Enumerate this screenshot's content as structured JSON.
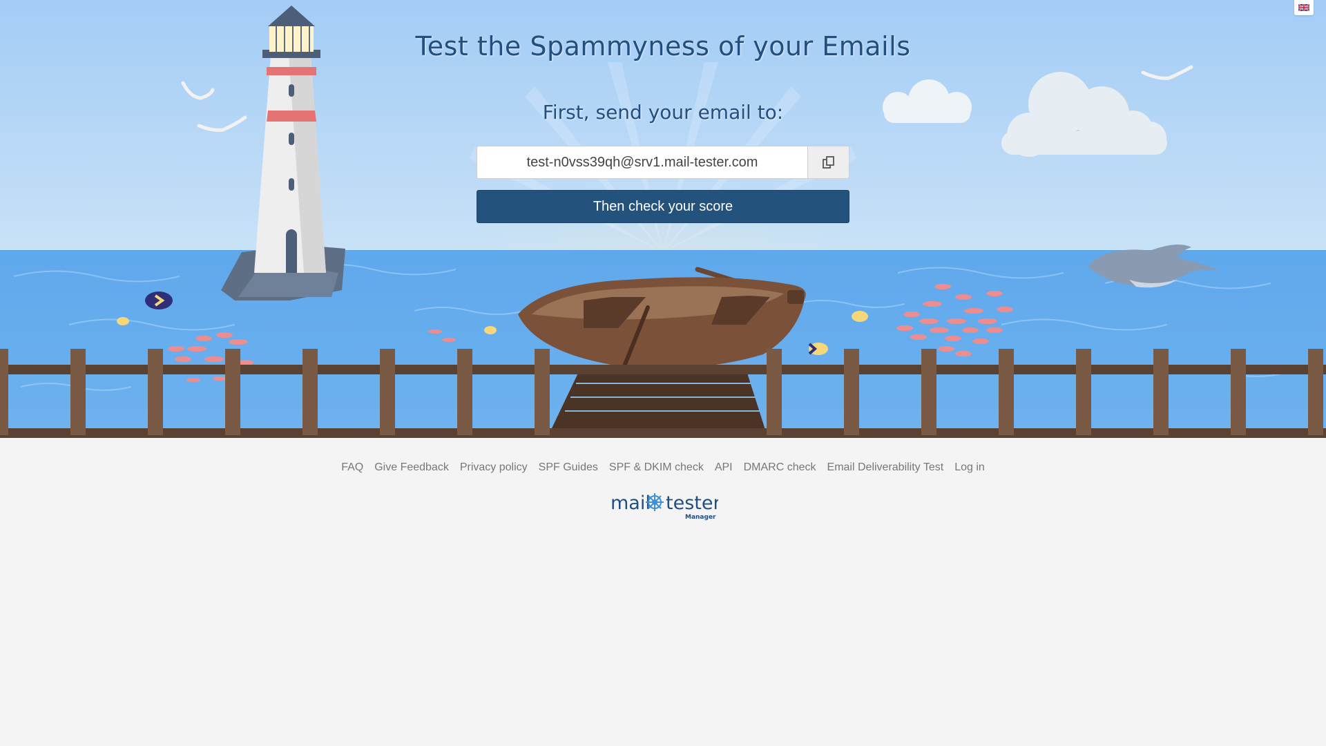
{
  "hero": {
    "title": "Test the Spammyness of your Emails",
    "subtitle": "First, send your email to:",
    "email_value": "test-n0vss39qh@srv1.mail-tester.com",
    "check_button_label": "Then check your score",
    "copy_icon": "copy-icon",
    "language_flag": "uk-flag-icon"
  },
  "footer": {
    "links": [
      "FAQ",
      "Give Feedback",
      "Privacy policy",
      "SPF Guides",
      "SPF & DKIM check",
      "API",
      "DMARC check",
      "Email Deliverability Test",
      "Log in"
    ],
    "logo": {
      "word1": "mail",
      "word2": "tester",
      "sub": "Manager"
    }
  },
  "colors": {
    "brand": "#23527c",
    "sky": "#a9d1f7",
    "sea": "#5aa6ea",
    "wood": "#6e4b36",
    "page_bg": "#f4f4f4"
  }
}
